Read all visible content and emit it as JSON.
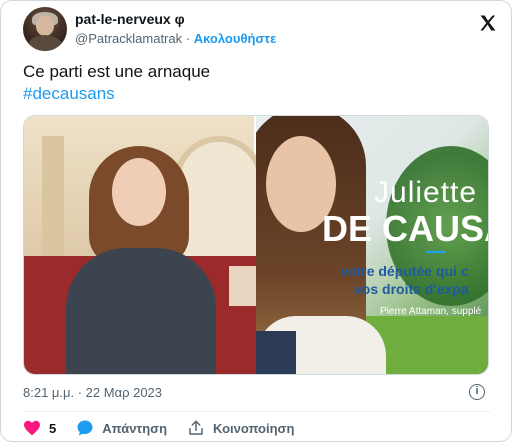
{
  "author": {
    "display_name": "pat-le-nerveux φ",
    "handle": "@Patracklamatrak",
    "separator": "·",
    "follow_label": "Ακολουθήστε"
  },
  "tweet": {
    "text": "Ce parti est une arnaque",
    "hashtag": "#decausans"
  },
  "media": {
    "overlay_first_name": "Juliette",
    "overlay_last_name": "DE CAUSA",
    "overlay_slogan_1": "votre députée qui c",
    "overlay_slogan_2": "vos droits d'expa",
    "overlay_supplement": "Pierre Attaman, supplé"
  },
  "meta": {
    "timestamp": "8:21 μ.μ. · 22 Μαρ 2023",
    "info_icon": "info-icon"
  },
  "actions": {
    "like_count": "5",
    "reply_label": "Απάντηση",
    "share_label": "Κοινοποίηση",
    "like_color": "#f91880",
    "reply_color": "#1d9bf0"
  },
  "colors": {
    "accent": "#1d9bf0",
    "text_secondary": "#536471"
  }
}
